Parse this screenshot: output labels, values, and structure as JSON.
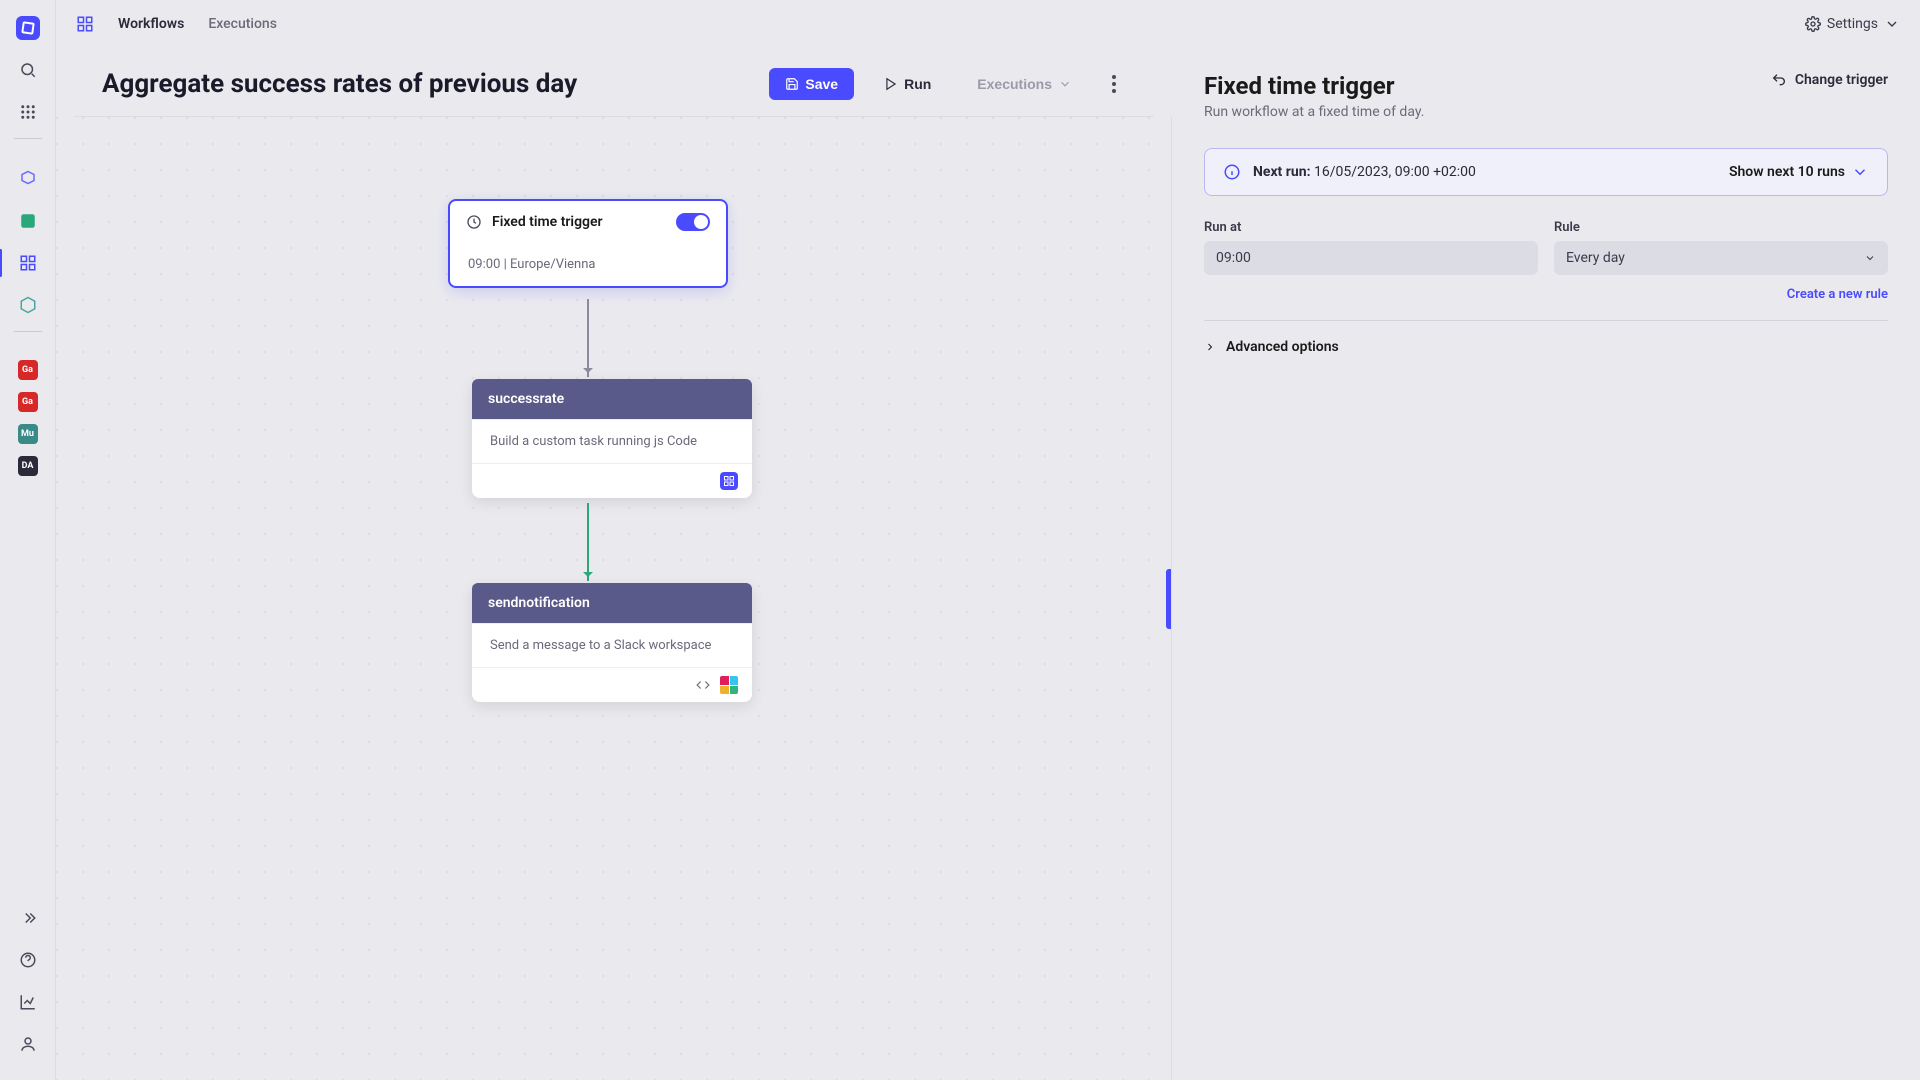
{
  "topbar": {
    "tabs": [
      "Workflows",
      "Executions"
    ],
    "settings_label": "Settings"
  },
  "page": {
    "title": "Aggregate success rates of previous day",
    "save_label": "Save",
    "run_label": "Run",
    "executions_label": "Executions"
  },
  "nodes": {
    "trigger": {
      "title": "Fixed time trigger",
      "schedule_text": "09:00 | Europe/Vienna"
    },
    "step1": {
      "title": "successrate",
      "desc": "Build a custom task running js Code"
    },
    "step2": {
      "title": "sendnotification",
      "desc": "Send a message to a Slack workspace"
    }
  },
  "side": {
    "title": "Fixed time trigger",
    "subtitle": "Run workflow at a fixed time of day.",
    "change_label": "Change trigger",
    "next_run_label": "Next run:",
    "next_run_value": "16/05/2023, 09:00 +02:00",
    "show_next_label": "Show next 10 runs",
    "run_at_label": "Run at",
    "run_at_value": "09:00",
    "rule_label": "Rule",
    "rule_value": "Every day",
    "create_rule_label": "Create a new rule",
    "advanced_label": "Advanced options"
  },
  "rail_apps": [
    "Ga",
    "Ga",
    "Mu",
    "DA"
  ]
}
